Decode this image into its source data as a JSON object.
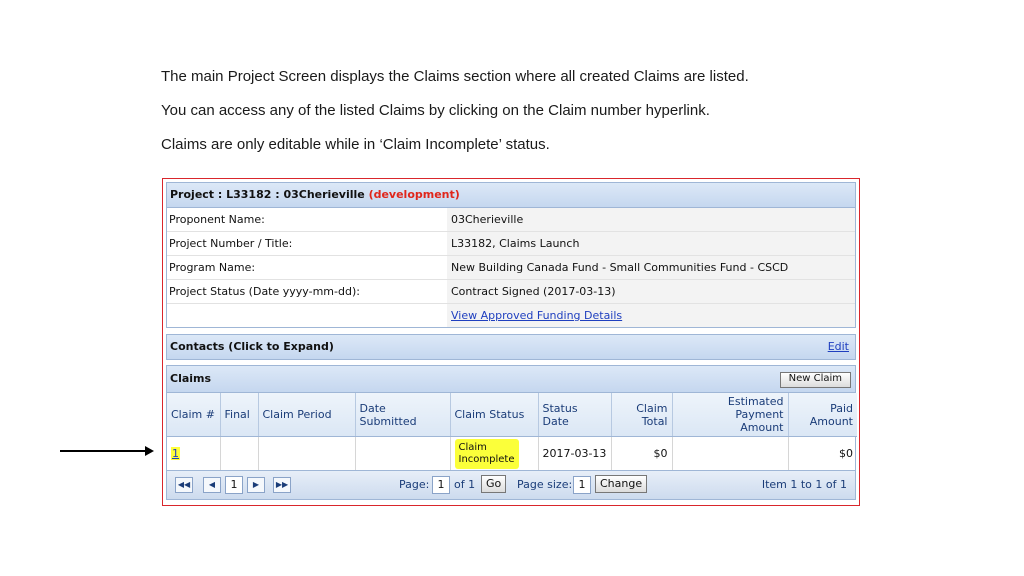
{
  "intro": {
    "line1": "The main Project Screen displays the Claims section where all created Claims are listed.",
    "line2": "You can access any of the listed Claims by clicking on the Claim number hyperlink.",
    "line3": "Claims are only editable while in ‘Claim Incomplete’ status."
  },
  "project": {
    "title": "Project : L33182 : 03Cherieville",
    "env": "(development)",
    "rows": [
      {
        "label": "Proponent Name:",
        "value": "03Cherieville"
      },
      {
        "label": "Project Number / Title:",
        "value": "L33182, Claims Launch"
      },
      {
        "label": "Program Name:",
        "value": "New Building Canada Fund - Small Communities Fund - CSCD"
      },
      {
        "label": "Project Status (Date yyyy-mm-dd):",
        "value": "Contract Signed (2017-03-13)"
      },
      {
        "label": "",
        "value": "View Approved Funding Details"
      }
    ]
  },
  "contacts": {
    "title": "Contacts (Click to Expand)",
    "edit": "Edit"
  },
  "claims": {
    "title": "Claims",
    "new_button": "New Claim",
    "columns": [
      "Claim #",
      "Final",
      "Claim Period",
      "Date Submitted",
      "Claim Status",
      "Status Date",
      "Claim Total",
      "Estimated Payment Amount",
      "Paid Amount"
    ],
    "col1": "Claim",
    "col1b": "Total",
    "col2": "Estimated Payment",
    "col2b": "Amount",
    "col3": "Paid",
    "col3b": "Amount",
    "row": {
      "claim_no": "1",
      "final": "",
      "period": "",
      "submitted": "",
      "status1": "Claim",
      "status2": "Incomplete",
      "status_date": "2017-03-13",
      "total": "$0",
      "estimated": "",
      "paid": "$0"
    }
  },
  "pager": {
    "page_label": "Page:",
    "page_value": "1",
    "of": "of 1",
    "go": "Go",
    "size_label": "Page size:",
    "size_value": "1",
    "change": "Change",
    "items": "Item 1 to 1 of 1",
    "current": "1"
  },
  "colors": {
    "highlight": "#fbff3a",
    "border_red": "#d9262c",
    "link": "#1f3fbf"
  }
}
